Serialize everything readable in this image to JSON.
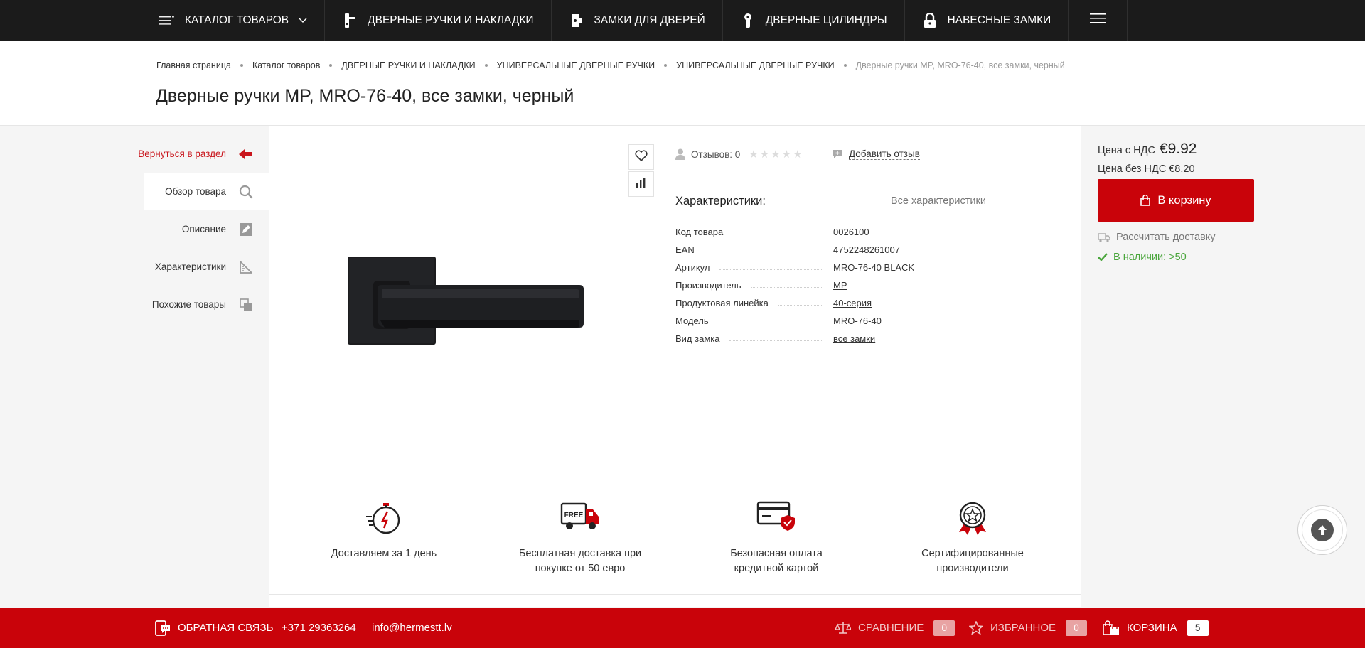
{
  "topnav": {
    "items": [
      {
        "label": "КАТАЛОГ ТОВАРОВ",
        "icon": "catalog-menu-icon"
      },
      {
        "label": "ДВЕРНЫЕ РУЧКИ И НАКЛАДКИ",
        "icon": "door-handle-icon"
      },
      {
        "label": "ЗАМКИ ДЛЯ ДВЕРЕЙ",
        "icon": "door-lock-icon"
      },
      {
        "label": "ДВЕРНЫЕ ЦИЛИНДРЫ",
        "icon": "cylinder-icon"
      },
      {
        "label": "НАВЕСНЫЕ ЗАМКИ",
        "icon": "padlock-icon"
      }
    ]
  },
  "breadcrumbs": [
    "Главная страница",
    "Каталог товаров",
    "ДВЕРНЫЕ РУЧКИ И НАКЛАДКИ",
    "УНИВЕРСАЛЬНЫЕ ДВЕРНЫЕ РУЧКИ",
    "УНИВЕРСАЛЬНЫЕ ДВЕРНЫЕ РУЧКИ",
    "Дверные ручки MP, MRO-76-40, все замки, черный"
  ],
  "page_title": "Дверные ручки MP, MRO-76-40, все замки, черный",
  "sidebar": {
    "back": "Вернуться в раздел",
    "items": [
      "Обзор товара",
      "Описание",
      "Характеристики",
      "Похожие товары"
    ]
  },
  "reviews": {
    "count_label": "Отзывов: 0",
    "rating": 0,
    "add_label": "Добавить отзыв"
  },
  "characteristics": {
    "title": "Характеристики:",
    "all_label": "Все характеристики",
    "rows": [
      {
        "key": "Код товара",
        "value": "0026100"
      },
      {
        "key": "EAN",
        "value": "4752248261007"
      },
      {
        "key": "Артикул",
        "value": "MRO-76-40 BLACK"
      },
      {
        "key": "Производитель",
        "value": "MP"
      },
      {
        "key": "Продуктовая линейка",
        "value": "40-серия"
      },
      {
        "key": "Модель",
        "value": "MRO-76-40"
      },
      {
        "key": "Вид замка",
        "value": "все замки"
      }
    ]
  },
  "features": [
    {
      "line1": "Доставляем за 1 день",
      "line2": ""
    },
    {
      "line1": "Бесплатная доставка при",
      "line2": "покупке от 50 евро"
    },
    {
      "line1": "Безопасная оплата",
      "line2": "кредитной картой"
    },
    {
      "line1": "Сертифицированные",
      "line2": "производители"
    }
  ],
  "free_badge": "FREE",
  "price": {
    "vat_label": "Цена с НДС",
    "vat_value": "€9.92",
    "novat_label": "Цена без НДС €8.20",
    "cart_label": "В корзину",
    "delivery_label": "Рассчитать доставку",
    "stock_label": "В наличии: >50"
  },
  "bottombar": {
    "feedback": "ОБРАТНАЯ СВЯЗЬ",
    "phone": "+371 29363264",
    "email": "info@hermestt.lv",
    "compare": "СРАВНЕНИЕ",
    "compare_count": "0",
    "favorites": "ИЗБРАННОЕ",
    "favorites_count": "0",
    "cart": "КОРЗИНА",
    "cart_count": "5"
  },
  "colors": {
    "accent": "#c9030a",
    "nav_bg": "#1b1b1b",
    "stock": "#4aa63c"
  }
}
